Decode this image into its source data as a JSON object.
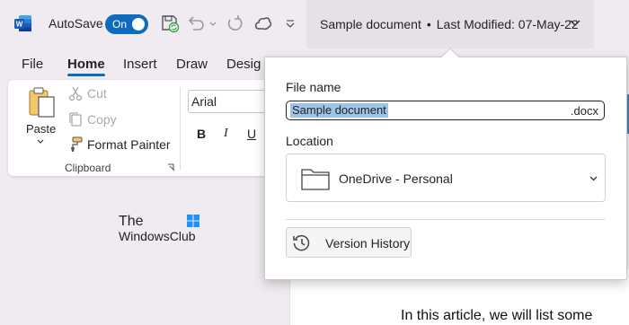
{
  "titlebar": {
    "app_icon": "word-icon",
    "autosave_label": "AutoSave",
    "autosave_state": "On",
    "document_name": "Sample document",
    "separator": "•",
    "last_modified": "Last Modified: 07-May-22"
  },
  "tabs": [
    {
      "label": "File",
      "active": false
    },
    {
      "label": "Home",
      "active": true
    },
    {
      "label": "Insert",
      "active": false
    },
    {
      "label": "Draw",
      "active": false
    },
    {
      "label": "Desig",
      "active": false
    }
  ],
  "ribbon": {
    "paste_label": "Paste",
    "cut_label": "Cut",
    "copy_label": "Copy",
    "format_painter_label": "Format Painter",
    "group_label": "Clipboard",
    "font_value": "Arial",
    "bold": "B",
    "italic": "I",
    "underline": "U"
  },
  "watermark": {
    "line1": "The",
    "line2": "WindowsClub"
  },
  "popup": {
    "file_name_label": "File name",
    "file_name_value": "Sample document",
    "file_extension": ".docx",
    "location_label": "Location",
    "location_value": "OneDrive - Personal",
    "version_history_label": "Version History"
  },
  "document": {
    "visible_text": "In this article, we will list some"
  },
  "colors": {
    "accent": "#0f6cbd",
    "selection": "#9cc3e8",
    "titlebar_bg": "#f0ebf0"
  }
}
